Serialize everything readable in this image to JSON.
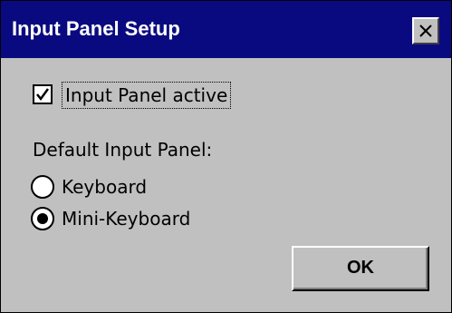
{
  "window": {
    "title": "Input Panel Setup",
    "close_icon": "close-icon",
    "colors": {
      "titlebar": "#0a0a80",
      "title_text": "#ffffff",
      "face": "#c0c0c0"
    }
  },
  "checkbox": {
    "label": "Input Panel active",
    "checked": true
  },
  "input_panel_group": {
    "label": "Default Input Panel:",
    "options": [
      {
        "label": "Keyboard",
        "selected": false
      },
      {
        "label": "Mini-Keyboard",
        "selected": true
      }
    ]
  },
  "buttons": {
    "ok_label": "OK"
  }
}
